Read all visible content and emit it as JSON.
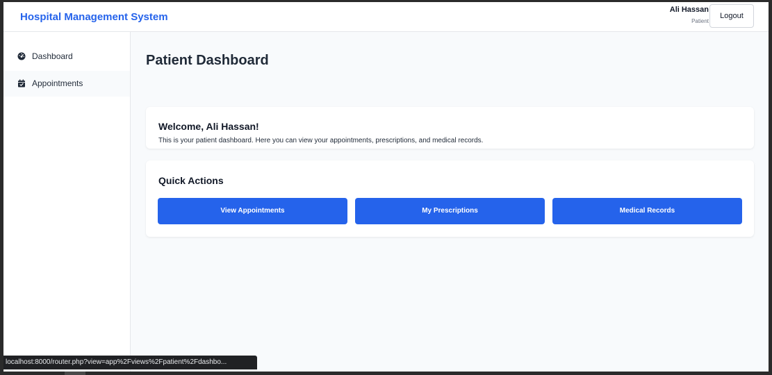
{
  "header": {
    "app_title": "Hospital Management System",
    "user_name": "Ali Hassan",
    "user_role": "Patient",
    "logout_label": "Logout"
  },
  "sidebar": {
    "items": [
      {
        "label": "Dashboard",
        "icon": "dashboard-gauge-icon"
      },
      {
        "label": "Appointments",
        "icon": "calendar-check-icon"
      }
    ]
  },
  "main": {
    "page_title": "Patient Dashboard",
    "welcome": {
      "title": "Welcome, Ali Hassan!",
      "text": "This is your patient dashboard. Here you can view your appointments, prescriptions, and medical records."
    },
    "quick_actions": {
      "title": "Quick Actions",
      "buttons": [
        "View Appointments",
        "My Prescriptions",
        "Medical Records"
      ]
    }
  },
  "status_url": "localhost:8000/router.php?view=app%2Fviews%2Fpatient%2Fdashbo...",
  "colors": {
    "accent": "#2563eb",
    "background": "#f8fafc",
    "card": "#ffffff"
  }
}
